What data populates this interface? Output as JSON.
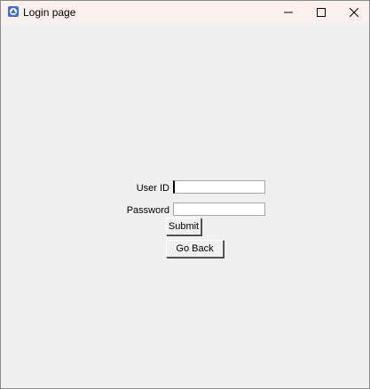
{
  "window": {
    "title": "Login page",
    "app_icon": "tk-feather-icon",
    "controls": {
      "minimize_icon": "minimize-icon",
      "maximize_icon": "maximize-icon",
      "close_icon": "close-icon"
    }
  },
  "form": {
    "user_id_label": "User ID",
    "user_id_value": "",
    "password_label": "Password",
    "password_value": "",
    "submit_label": "Submit",
    "go_back_label": "Go Back"
  },
  "colors": {
    "titlebar_bg": "#fbf1ec",
    "client_bg": "#f0f0f0",
    "entry_bg": "#ffffff"
  }
}
